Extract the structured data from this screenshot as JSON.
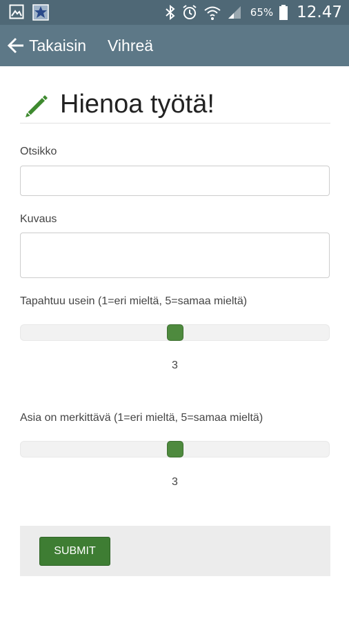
{
  "status_bar": {
    "battery_percent": "65%",
    "time": "12.47",
    "icons": [
      "gallery-icon",
      "app-notification-icon",
      "bluetooth-icon",
      "alarm-icon",
      "wifi-icon",
      "signal-icon",
      "battery-icon"
    ]
  },
  "app_bar": {
    "back_label": "Takaisin",
    "title": "Vihreä"
  },
  "form": {
    "heading": "Hienoa työtä!",
    "title_label": "Otsikko",
    "title_value": "",
    "description_label": "Kuvaus",
    "description_value": "",
    "frequency_label": "Tapahtuu usein (1=eri mieltä, 5=samaa mieltä)",
    "frequency_value": "3",
    "frequency_min": 1,
    "frequency_max": 5,
    "importance_label": "Asia on merkittävä (1=eri mieltä, 5=samaa mieltä)",
    "importance_value": "3",
    "importance_min": 1,
    "importance_max": 5,
    "submit_label": "SUBMIT"
  },
  "colors": {
    "status_bar": "#4f6876",
    "app_bar": "#5d7887",
    "accent_green": "#3e7d33",
    "slider_thumb": "#4e8a3e"
  }
}
